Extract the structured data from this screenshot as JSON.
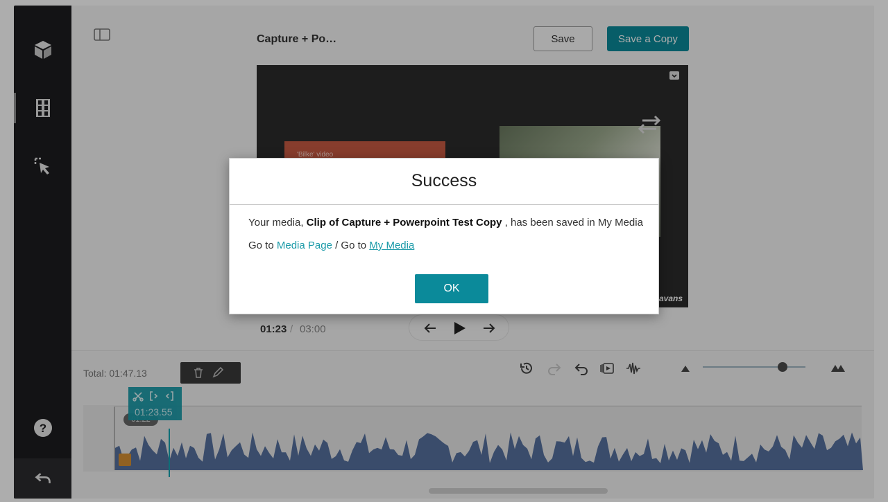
{
  "header": {
    "media_title": "Capture + Po…",
    "save_label": "Save",
    "save_copy_label": "Save a Copy"
  },
  "player": {
    "slide_text": "'Bilke' video",
    "brand_text": "avans",
    "current_time": "01:23",
    "separator": "/",
    "total_time": "03:00"
  },
  "timeline": {
    "total_label": "Total: 01:47.13",
    "marker_time": "01:22",
    "cut_time": "01:23.55",
    "zoom_level": 0.78
  },
  "dialog": {
    "title": "Success",
    "msg_prefix": "Your media, ",
    "msg_bold": "Clip of Capture + Powerpoint Test Copy",
    "msg_suffix": " , has been saved in My Media",
    "goto_prefix": "Go to ",
    "media_page_link": "Media Page",
    "goto_middle": " / Go to ",
    "my_media_link": "My Media",
    "ok_label": "OK"
  },
  "colors": {
    "accent": "#0b8a9a",
    "sidebar": "#1d1d1f",
    "waveform": "#56709e"
  }
}
